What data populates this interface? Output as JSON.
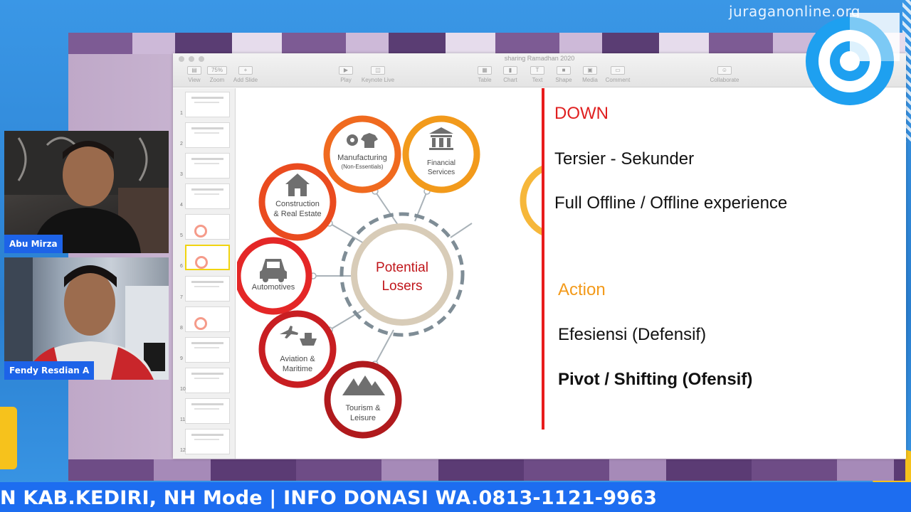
{
  "broadcast": {
    "watermark": "juraganonline.org",
    "ticker": "N KAB.KEDIRI, NH Mode | INFO DONASI WA.0813-1121-9963",
    "brand_color": "#1d6df0"
  },
  "participants": [
    {
      "name": "Abu Mirza"
    },
    {
      "name": "Fendy Resdian A"
    }
  ],
  "keynote": {
    "document_title": "sharing Ramadhan 2020",
    "toolbar": [
      {
        "label": "View",
        "icon": "sidebar-icon"
      },
      {
        "label": "Zoom",
        "value": "75%"
      },
      {
        "label": "Add Slide",
        "icon": "plus-icon"
      },
      {
        "label": "Play",
        "icon": "play-icon"
      },
      {
        "label": "Keynote Live",
        "icon": "broadcast-icon"
      },
      {
        "label": "Table",
        "icon": "table-icon"
      },
      {
        "label": "Chart",
        "icon": "chart-icon"
      },
      {
        "label": "Text",
        "icon": "text-icon"
      },
      {
        "label": "Shape",
        "icon": "shape-icon"
      },
      {
        "label": "Media",
        "icon": "media-icon"
      },
      {
        "label": "Comment",
        "icon": "comment-icon"
      },
      {
        "label": "Collaborate",
        "icon": "collaborate-icon"
      }
    ],
    "slide_numbers": [
      "1",
      "2",
      "3",
      "4",
      "5",
      "6",
      "7",
      "8",
      "9",
      "10",
      "11",
      "12"
    ],
    "selected_slide": 6
  },
  "slide": {
    "center_label": [
      "Potential",
      "Losers"
    ],
    "sectors": [
      {
        "lines": [
          "Manufacturing",
          "(Non-Essentials)"
        ],
        "icon": "gear-shirt-icon",
        "color": "#f06a1f"
      },
      {
        "lines": [
          "Financial",
          "Services"
        ],
        "icon": "bank-icon",
        "color": "#f29a1b"
      },
      {
        "lines": [
          "Construction",
          "& Real Estate"
        ],
        "icon": "house-icon",
        "color": "#ea4b1f"
      },
      {
        "lines": [
          "Automotives"
        ],
        "icon": "car-icon",
        "color": "#e42727"
      },
      {
        "lines": [
          "Aviation &",
          "Maritime"
        ],
        "icon": "plane-ship-icon",
        "color": "#c81e22"
      },
      {
        "lines": [
          "Tourism &",
          "Leisure"
        ],
        "icon": "mountains-icon",
        "color": "#b01a1d"
      }
    ],
    "heading_down": "DOWN",
    "down_items": [
      "Tersier - Sekunder",
      "Full Offline / Offline experience"
    ],
    "heading_action": "Action",
    "action_items": [
      "Efesiensi (Defensif)",
      "Pivot / Shifting (Ofensif)"
    ]
  }
}
